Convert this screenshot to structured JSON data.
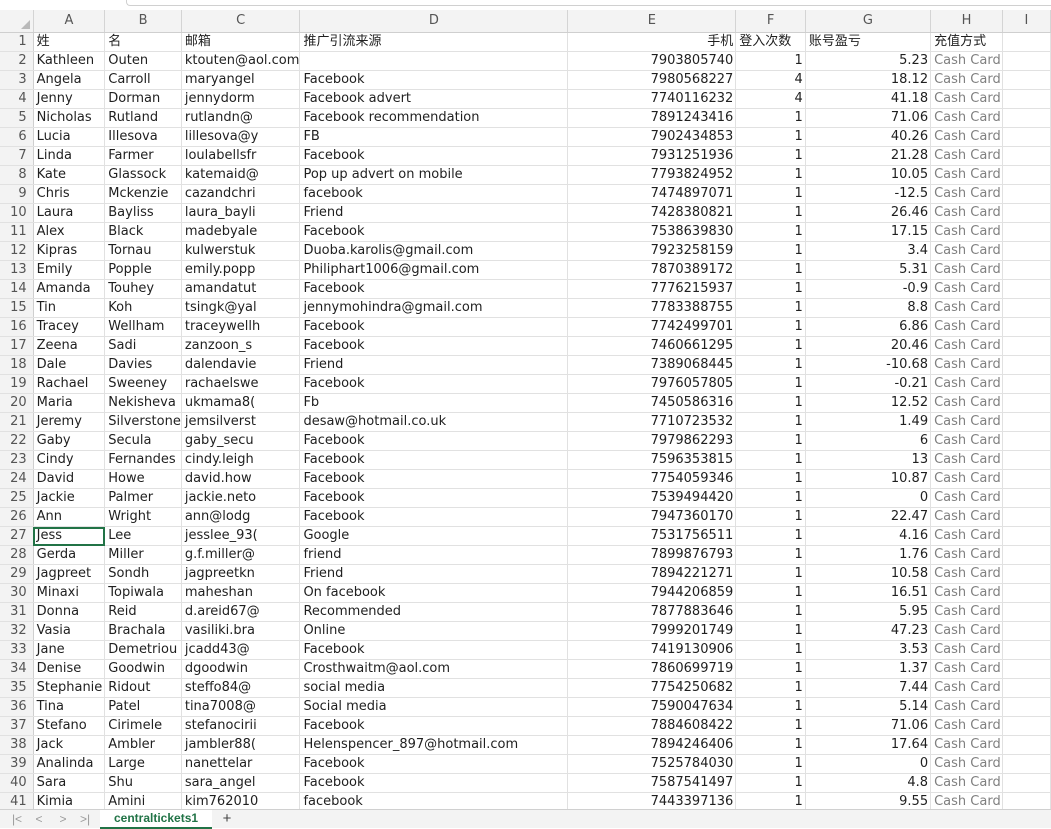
{
  "columns": [
    "A",
    "B",
    "C",
    "D",
    "E",
    "F",
    "G",
    "H",
    "I"
  ],
  "headers": {
    "last_name": "姓",
    "first_name": "名",
    "email": "邮箱",
    "source": "推广引流来源",
    "phone": "手机",
    "logins": "登入次数",
    "pnl": "账号盈亏",
    "payment": "充值方式"
  },
  "rows": [
    [
      "Kathleen",
      "Outen",
      "ktouten@aol.com",
      "",
      "7903805740",
      "1",
      "5.23",
      "Cash Card"
    ],
    [
      "Angela",
      "Carroll",
      "maryangel",
      "Facebook",
      "7980568227",
      "4",
      "18.12",
      "Cash Card"
    ],
    [
      "Jenny",
      "Dorman",
      "jennydorm",
      "Facebook advert",
      "7740116232",
      "4",
      "41.18",
      "Cash Card"
    ],
    [
      "Nicholas",
      "Rutland",
      "rutlandn@",
      "Facebook recommendation",
      "7891243416",
      "1",
      "71.06",
      "Cash Card"
    ],
    [
      "Lucia",
      "Illesova",
      "lillesova@y",
      "FB",
      "7902434853",
      "1",
      "40.26",
      "Cash Card"
    ],
    [
      "Linda",
      "Farmer",
      "loulabellsfr",
      "Facebook",
      "7931251936",
      "1",
      "21.28",
      "Cash Card"
    ],
    [
      "Kate",
      "Glassock",
      "katemaid@",
      "Pop up advert on mobile",
      "7793824952",
      "1",
      "10.05",
      "Cash Card"
    ],
    [
      "Chris",
      "Mckenzie",
      "cazandchri",
      "facebook",
      "7474897071",
      "1",
      "-12.5",
      "Cash Card"
    ],
    [
      "Laura",
      "Bayliss",
      "laura_bayli",
      "Friend",
      "7428380821",
      "1",
      "26.46",
      "Cash Card"
    ],
    [
      "Alex",
      "Black",
      "madebyale",
      "Facebook",
      "7538639830",
      "1",
      "17.15",
      "Cash Card"
    ],
    [
      "Kipras",
      "Tornau",
      "kulwerstuk",
      "Duoba.karolis@gmail.com",
      "7923258159",
      "1",
      "3.4",
      "Cash Card"
    ],
    [
      "Emily",
      "Popple",
      "emily.popp",
      "Philiphart1006@gmail.com",
      "7870389172",
      "1",
      "5.31",
      "Cash Card"
    ],
    [
      "Amanda",
      "Touhey",
      "amandatut",
      "Facebook",
      "7776215937",
      "1",
      "-0.9",
      "Cash Card"
    ],
    [
      "Tin",
      "Koh",
      "tsingk@yal",
      "jennymohindra@gmail.com",
      "7783388755",
      "1",
      "8.8",
      "Cash Card"
    ],
    [
      "Tracey",
      "Wellham",
      "traceywellh",
      "Facebook",
      "7742499701",
      "1",
      "6.86",
      "Cash Card"
    ],
    [
      "Zeena",
      "Sadi",
      "zanzoon_s",
      "Facebook",
      "7460661295",
      "1",
      "20.46",
      "Cash Card"
    ],
    [
      "Dale",
      "Davies",
      "dalendavie",
      "Friend",
      "7389068445",
      "1",
      "-10.68",
      "Cash Card"
    ],
    [
      "Rachael",
      "Sweeney",
      "rachaelswe",
      "Facebook",
      "7976057805",
      "1",
      "-0.21",
      "Cash Card"
    ],
    [
      "Maria",
      "Nekisheva",
      "ukmama8(",
      "Fb",
      "7450586316",
      "1",
      "12.52",
      "Cash Card"
    ],
    [
      "Jeremy",
      "Silverstone",
      "jemsilverst",
      "desaw@hotmail.co.uk",
      "7710723532",
      "1",
      "1.49",
      "Cash Card"
    ],
    [
      "Gaby",
      "Secula",
      "gaby_secu",
      "Facebook",
      "7979862293",
      "1",
      "6",
      "Cash Card"
    ],
    [
      "Cindy",
      "Fernandes",
      "cindy.leigh",
      "Facebook",
      "7596353815",
      "1",
      "13",
      "Cash Card"
    ],
    [
      "David",
      "Howe",
      "david.how",
      "Facebook",
      "7754059346",
      "1",
      "10.87",
      "Cash Card"
    ],
    [
      "Jackie",
      "Palmer",
      "jackie.neto",
      "Facebook",
      "7539494420",
      "1",
      "0",
      "Cash Card"
    ],
    [
      "Ann",
      "Wright",
      "ann@lodg",
      "Facebook",
      "7947360170",
      "1",
      "22.47",
      "Cash Card"
    ],
    [
      "Jess",
      "Lee",
      "jesslee_93(",
      "Google",
      "7531756511",
      "1",
      "4.16",
      "Cash Card"
    ],
    [
      "Gerda",
      "Miller",
      "g.f.miller@",
      "friend",
      "7899876793",
      "1",
      "1.76",
      "Cash Card"
    ],
    [
      "Jagpreet",
      "Sondh",
      "jagpreetkn",
      "Friend",
      "7894221271",
      "1",
      "10.58",
      "Cash Card"
    ],
    [
      "Minaxi",
      "Topiwala",
      "maheshan",
      "On facebook",
      "7944206859",
      "1",
      "16.51",
      "Cash Card"
    ],
    [
      "Donna",
      "Reid",
      "d.areid67@",
      "Recommended",
      "7877883646",
      "1",
      "5.95",
      "Cash Card"
    ],
    [
      "Vasia",
      "Brachala",
      "vasiliki.bra",
      "Online",
      "7999201749",
      "1",
      "47.23",
      "Cash Card"
    ],
    [
      "Jane",
      "Demetriou",
      "jcadd43@",
      "Facebook",
      "7419130906",
      "1",
      "3.53",
      "Cash Card"
    ],
    [
      "Denise",
      "Goodwin",
      "dgoodwin",
      "Crosthwaitm@aol.com",
      "7860699719",
      "1",
      "1.37",
      "Cash Card"
    ],
    [
      "Stephanie",
      "Ridout",
      "steffo84@",
      "social media",
      "7754250682",
      "1",
      "7.44",
      "Cash Card"
    ],
    [
      "Tina",
      "Patel",
      "tina7008@",
      "Social media",
      "7590047634",
      "1",
      "5.14",
      "Cash Card"
    ],
    [
      "Stefano",
      "Cirimele",
      "stefanocirii",
      "Facebook",
      "7884608422",
      "1",
      "71.06",
      "Cash Card"
    ],
    [
      "Jack",
      "Ambler",
      "jambler88(",
      "Helenspencer_897@hotmail.com",
      "7894246406",
      "1",
      "17.64",
      "Cash Card"
    ],
    [
      "Analinda",
      "Large",
      "nanettelar",
      "Facebook",
      "7525784030",
      "1",
      "0",
      "Cash Card"
    ],
    [
      "Sara",
      "Shu",
      "sara_angel",
      "Facebook",
      "7587541497",
      "1",
      "4.8",
      "Cash Card"
    ],
    [
      "Kimia",
      "Amini",
      "kim762010",
      "facebook",
      "7443397136",
      "1",
      "9.55",
      "Cash Card"
    ]
  ],
  "sheet_tab": "centraltickets1",
  "add_sheet": "+",
  "nav": {
    "first": "|<",
    "prev": "<",
    "next": ">",
    "last": ">|"
  }
}
